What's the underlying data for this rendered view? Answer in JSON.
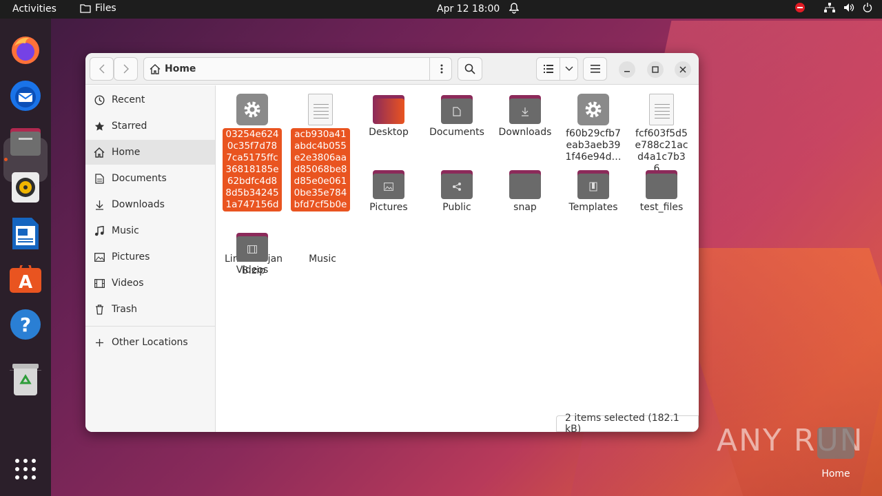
{
  "topbar": {
    "activities": "Activities",
    "app_name": "Files",
    "clock": "Apr 12  18:00"
  },
  "window": {
    "path": "Home"
  },
  "sidebar": {
    "items": [
      {
        "label": "Recent",
        "icon": "clock-icon"
      },
      {
        "label": "Starred",
        "icon": "star-icon"
      },
      {
        "label": "Home",
        "icon": "home-icon"
      },
      {
        "label": "Documents",
        "icon": "document-icon"
      },
      {
        "label": "Downloads",
        "icon": "download-icon"
      },
      {
        "label": "Music",
        "icon": "music-icon"
      },
      {
        "label": "Pictures",
        "icon": "picture-icon"
      },
      {
        "label": "Videos",
        "icon": "video-icon"
      },
      {
        "label": "Trash",
        "icon": "trash-icon"
      }
    ],
    "other_locations": "Other Locations"
  },
  "files": [
    {
      "name": "03254e6240c35f7d787ca5175ffc36818185e62bdfc4d88d5b342451a747156d",
      "type": "executable",
      "selected": true
    },
    {
      "name": "acb930a41abdc4b055e2e3806aad85068be8d85e0e0610be35e784bfd7cf5b0e",
      "type": "text",
      "selected": true
    },
    {
      "name": "Desktop",
      "type": "folder-desktop"
    },
    {
      "name": "Documents",
      "type": "folder-documents"
    },
    {
      "name": "Downloads",
      "type": "folder-downloads"
    },
    {
      "name": "f60b29cfb7eab3aeb391f46e94d…",
      "type": "executable"
    },
    {
      "name": "fcf603f5d5e788c21acd4a1c7b36…",
      "type": "text"
    },
    {
      "name": "Pictures",
      "type": "folder-pictures"
    },
    {
      "name": "Public",
      "type": "folder-public"
    },
    {
      "name": "snap",
      "type": "folder"
    },
    {
      "name": "Templates",
      "type": "folder-templates"
    },
    {
      "name": "test_files",
      "type": "folder"
    },
    {
      "name": "Videos",
      "type": "folder-videos"
    }
  ],
  "behind_labels": {
    "zip_name_line1": "Linux.Trojan.Mirai-",
    "zip_name_line2": "B.zip",
    "music": "Music"
  },
  "status": "2 items selected  (182.1 kB)",
  "watermark": "ANY RUN",
  "desktop": {
    "home_label": "Home"
  },
  "colors": {
    "accent": "#e95420",
    "folder_tab": "#8c2a5a",
    "folder_body": "#6a6a6a"
  }
}
